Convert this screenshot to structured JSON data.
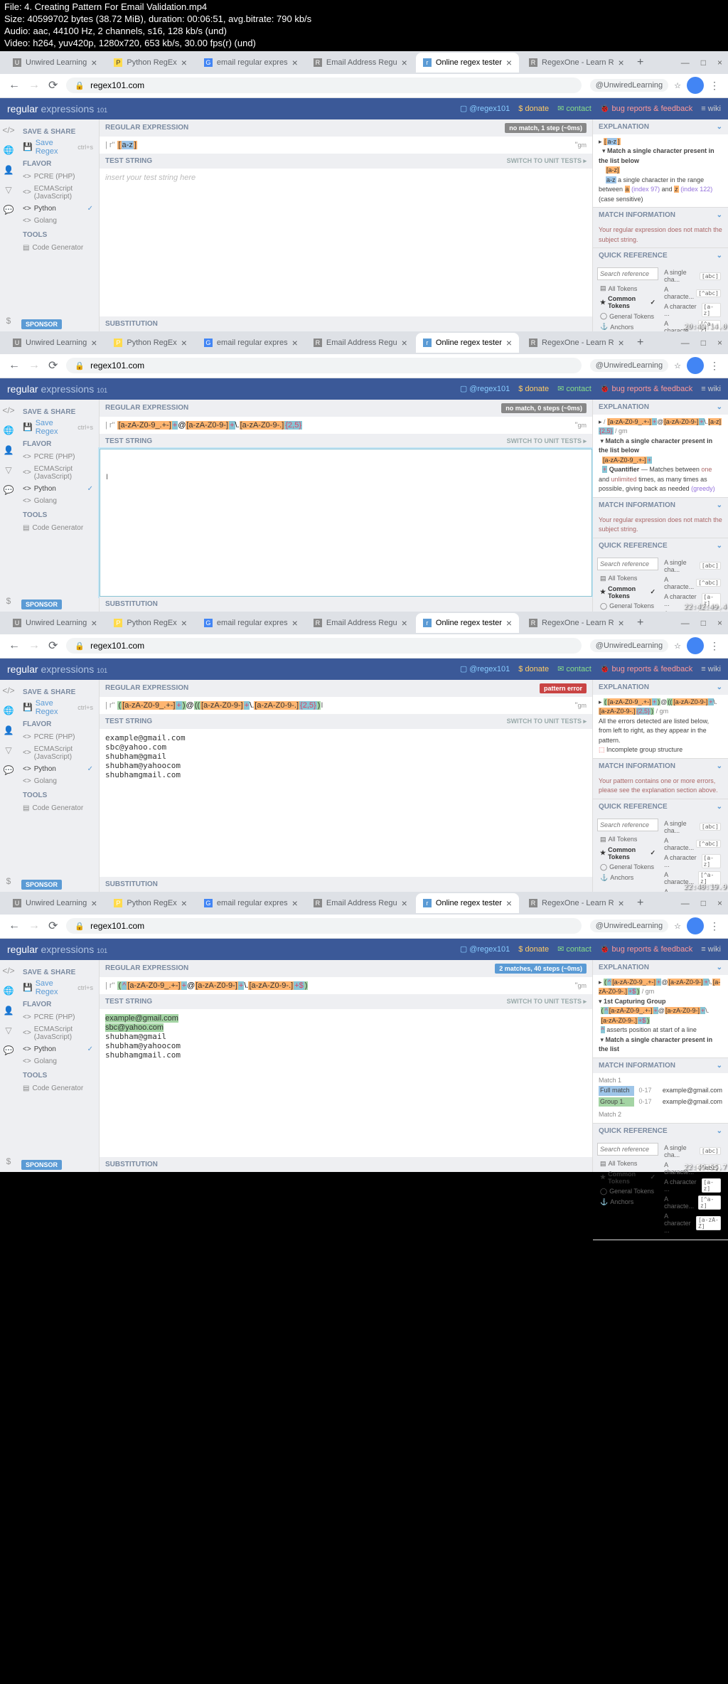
{
  "file_info": {
    "l1": "File: 4. Creating Pattern For Email Validation.mp4",
    "l2": "Size: 40599702 bytes (38.72 MiB), duration: 00:06:51, avg.bitrate: 790 kb/s",
    "l3": "Audio: aac, 44100 Hz, 2 channels, s16, 128 kb/s (und)",
    "l4": "Video: h264, yuv420p, 1280x720, 653 kb/s, 30.00 fps(r) (und)"
  },
  "tabs": {
    "t1": "Unwired Learning",
    "t2": "Python RegEx",
    "t3": "email regular expres",
    "t4": "Email Address Regu",
    "t5": "Online regex tester",
    "t6": "RegexOne - Learn R"
  },
  "url": "regex101.com",
  "profile": "@UnwiredLearning",
  "app": {
    "title1": "regular",
    "title2": "expressions",
    "ver": "101"
  },
  "header_links": {
    "l1": "@regex101",
    "l2": "$ donate",
    "l3": "contact",
    "l4": "bug reports & feedback",
    "l5": "wiki"
  },
  "left": {
    "save_share": "SAVE & SHARE",
    "save_regex": "Save Regex",
    "shortcut": "ctrl+s",
    "flavor": "FLAVOR",
    "f1": "PCRE (PHP)",
    "f2": "ECMAScript (JavaScript)",
    "f3": "Python",
    "f4": "Golang",
    "tools": "TOOLS",
    "t1": "Code Generator",
    "sponsor": "SPONSOR"
  },
  "center": {
    "regex_title": "REGULAR EXPRESSION",
    "test_title": "TEST STRING",
    "unit": "SWITCH TO UNIT TESTS ▸",
    "sub": "SUBSTITUTION",
    "flags": "gm",
    "placeholder": "insert your test string here"
  },
  "right": {
    "explanation": "EXPLANATION",
    "match_info": "MATCH INFORMATION",
    "quick_ref": "QUICK REFERENCE",
    "search": "Search reference",
    "tok1": "All Tokens",
    "tok2": "Common Tokens",
    "tok3": "General Tokens",
    "tok4": "Anchors",
    "ref1": "A single cha...",
    "ref1c": "[abc]",
    "ref2": "A characte...",
    "ref2c": "[^abc]",
    "ref3": "A character ...",
    "ref3c": "[a-z]",
    "ref4": "A characte...",
    "ref4c": "[^a-z]",
    "ref5": "A character ...",
    "ref5c": "[a-zA-Z]"
  },
  "panel1": {
    "status": "no match, 1 step (~0ms)",
    "regex_content": "[a-z]",
    "exp1": "Match a single character present in the list below",
    "exp2": "a single character in the range between",
    "exp3": "(index 97)",
    "exp4": "and",
    "exp5": "(index 122)",
    "exp6": "(case sensitive)",
    "match_msg": "Your regular expression does not match the subject string.",
    "ts": "20:49:14.0"
  },
  "panel2": {
    "status": "no match, 0 steps (~0ms)",
    "exp1": "Match a single character present in the list below",
    "exp2": "Quantifier",
    "exp3": "Matches between",
    "exp4": "one",
    "exp5": "and",
    "exp6": "unlimited",
    "exp7": "times, as many times as possible, giving back as needed",
    "exp8": "(greedy)",
    "ts": "22:42:49.4"
  },
  "panel3": {
    "status": "pattern error",
    "test_text": "example@gmail.com\nsbc@yahoo.com\nshubham@gmail\nshubham@yahoocom\nshubhamgmail.com",
    "exp1": "All the errors detected are listed below, from left to right, as they appear in the pattern.",
    "exp2": "Incomplete group structure",
    "match_msg": "Your pattern contains one or more errors, please see the explanation section above.",
    "ts": "22:40:19.9"
  },
  "panel4": {
    "status": "2 matches, 40 steps (~0ms)",
    "exp1": "1st Capturing Group",
    "exp2": "asserts position at start of a line",
    "exp3": "Match a single character present in the list",
    "m1": "Match 1",
    "m1a": "Full match",
    "m1b": "0-17",
    "m1c": "example@gmail.com",
    "m2a": "Group 1.",
    "m2b": "0-17",
    "m2c": "example@gmail.com",
    "m3": "Match 2",
    "ts": "22:49:55.7"
  }
}
